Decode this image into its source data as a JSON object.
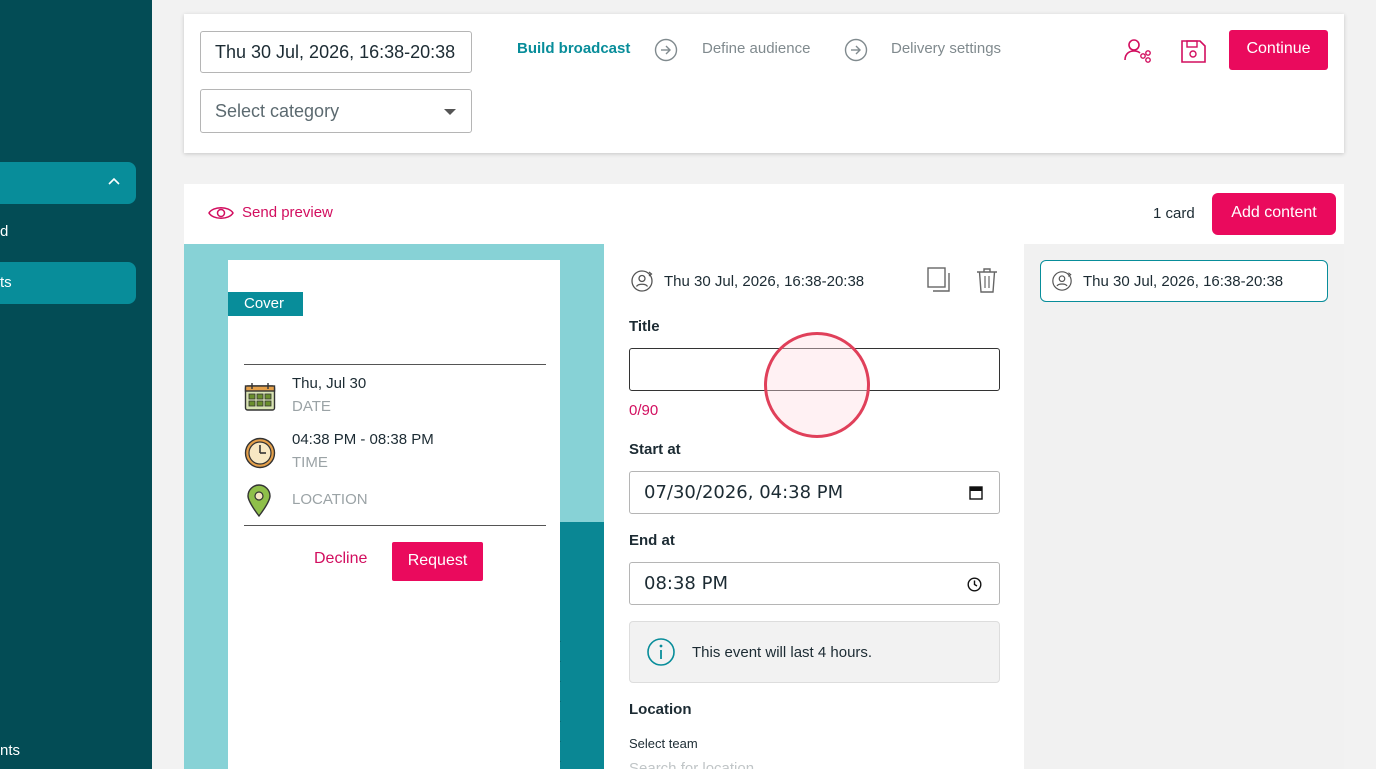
{
  "sidebar": {
    "item_1": "d",
    "item_2": "ts",
    "item_3": "nts"
  },
  "header": {
    "date_value": "Thu 30 Jul, 2026, 16:38-20:38",
    "category_placeholder": "Select category",
    "steps": [
      "Build broadcast",
      "Define audience",
      "Delivery settings"
    ],
    "continue_label": "Continue"
  },
  "toolbar": {
    "send_preview_label": "Send preview",
    "card_count": "1 card",
    "add_content_label": "Add content"
  },
  "preview": {
    "cover_label": "Cover",
    "date_value": "Thu, Jul 30",
    "date_label": "DATE",
    "time_value": "04:38 PM - 08:38 PM",
    "time_label": "TIME",
    "location_label": "LOCATION",
    "decline_label": "Decline",
    "request_label": "Request"
  },
  "form": {
    "card_heading": "Thu 30 Jul, 2026, 16:38-20:38",
    "title_label": "Title",
    "title_value": "",
    "title_counter": "0/90",
    "start_label": "Start at",
    "start_value": "07/30/2026, 04:38 PM",
    "end_label": "End at",
    "end_value": "08:38 PM",
    "info_text": "This event will last 4 hours.",
    "location_label": "Location",
    "select_team_label": "Select team",
    "location_placeholder": "Search for location"
  },
  "card_list": {
    "items": [
      "Thu 30 Jul, 2026, 16:38-20:38"
    ]
  },
  "colors": {
    "sidebar": "#034c55",
    "accent_teal": "#088d9a",
    "brand_pink": "#ea0a5d",
    "preview_bg": "#87d2d6"
  }
}
